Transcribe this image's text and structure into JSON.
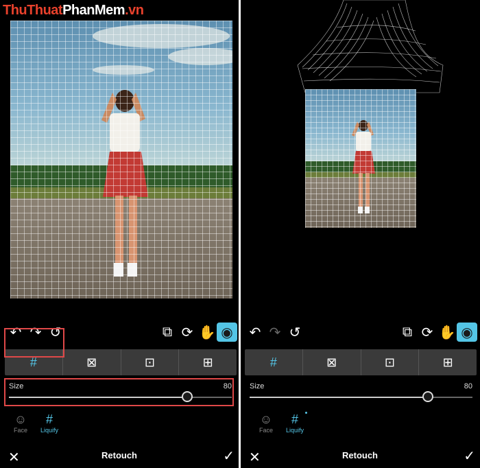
{
  "watermark": {
    "part1": "ThuThuat",
    "part2": "PhanMem",
    "part3": ".vn"
  },
  "left": {
    "size": {
      "label": "Size",
      "value": "80",
      "fraction": 0.8
    },
    "modes": {
      "face": "Face",
      "liquify": "Liquify"
    },
    "bottom": {
      "title": "Retouch"
    }
  },
  "right": {
    "size": {
      "label": "Size",
      "value": "80",
      "fraction": 0.8
    },
    "modes": {
      "face": "Face",
      "liquify": "Liquify"
    },
    "bottom": {
      "title": "Retouch"
    }
  },
  "icons": {
    "undo": "↶",
    "redo": "↷",
    "reset": "↺",
    "compare": "⧉",
    "rotate": "⟳",
    "hand": "✋",
    "eye": "◉",
    "liquify": "#",
    "bloat": "⊠",
    "pucker": "⊡",
    "grid": "⊞",
    "close": "✕",
    "confirm": "✓",
    "face": "☺"
  },
  "colors": {
    "accent": "#54c5e6",
    "highlight": "#e04848",
    "watermark_red": "#e8412c"
  }
}
